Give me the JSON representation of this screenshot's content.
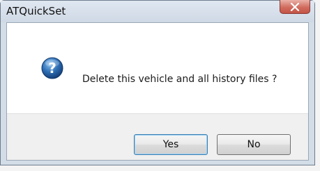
{
  "window": {
    "title": "ATQuickSet",
    "close_icon": "close-icon"
  },
  "message": {
    "icon": "question-icon",
    "text": "Delete this vehicle and all history files ?"
  },
  "buttons": {
    "yes_label": "Yes",
    "no_label": "No"
  },
  "colors": {
    "close_button": "#d16c5f",
    "question_icon": "#2f6fb5",
    "default_button_border": "#3c7fb1"
  }
}
